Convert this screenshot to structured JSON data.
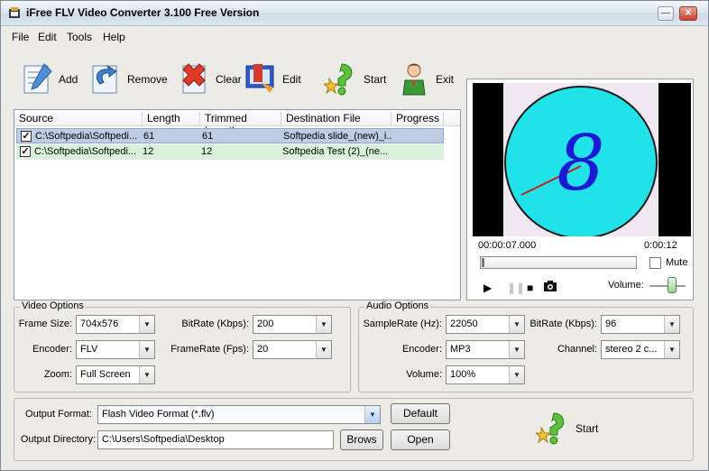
{
  "window": {
    "title": "iFree FLV Video Converter 3.100  Free Version"
  },
  "menu": {
    "file": "File",
    "edit": "Edit",
    "tools": "Tools",
    "help": "Help"
  },
  "toolbar": {
    "add": "Add",
    "remove": "Remove",
    "clear": "Clear",
    "edit": "Edit",
    "start": "Start",
    "exit": "Exit"
  },
  "list": {
    "columns": {
      "source": "Source",
      "length": "Length",
      "trimmed": "Trimmed Length",
      "dest": "Destination File",
      "progress": "Progress"
    },
    "rows": [
      {
        "source": "C:\\Softpedia\\Softpedi...",
        "length": "61",
        "trimmed": "61",
        "dest": "Softpedia slide_(new)_i..."
      },
      {
        "source": "C:\\Softpedia\\Softpedi...",
        "length": "12",
        "trimmed": "12",
        "dest": "Softpedia Test (2)_(ne..."
      }
    ]
  },
  "preview": {
    "frame_digit": "8",
    "time_current": "00:00:07.000",
    "time_total": "0:00:12",
    "mute": "Mute",
    "volume": "Volume:",
    "colors": {
      "clock_face": "#1fe3e8",
      "digit": "#1a1ad6",
      "hand": "#c42020"
    }
  },
  "video_options": {
    "title": "Video Options",
    "frame_size_label": "Frame Size:",
    "frame_size": "704x576",
    "bitrate_label": "BitRate (Kbps):",
    "bitrate": "200",
    "encoder_label": "Encoder:",
    "encoder": "FLV",
    "framerate_label": "FrameRate (Fps):",
    "framerate": "20",
    "zoom_label": "Zoom:",
    "zoom": "Full Screen"
  },
  "audio_options": {
    "title": "Audio Options",
    "samplerate_label": "SampleRate (Hz):",
    "samplerate": "22050",
    "bitrate_label": "BitRate (Kbps):",
    "bitrate": "96",
    "encoder_label": "Encoder:",
    "encoder": "MP3",
    "channel_label": "Channel:",
    "channel": "stereo 2 c...",
    "volume_label": "Volume:",
    "volume": "100%"
  },
  "output": {
    "format_label": "Output Format:",
    "format": "Flash Video Format (*.flv)",
    "default_btn": "Default",
    "dir_label": "Output Directory:",
    "dir": "C:\\Users\\Softpedia\\Desktop",
    "browse_btn": "Brows",
    "open_btn": "Open",
    "start": "Start"
  }
}
